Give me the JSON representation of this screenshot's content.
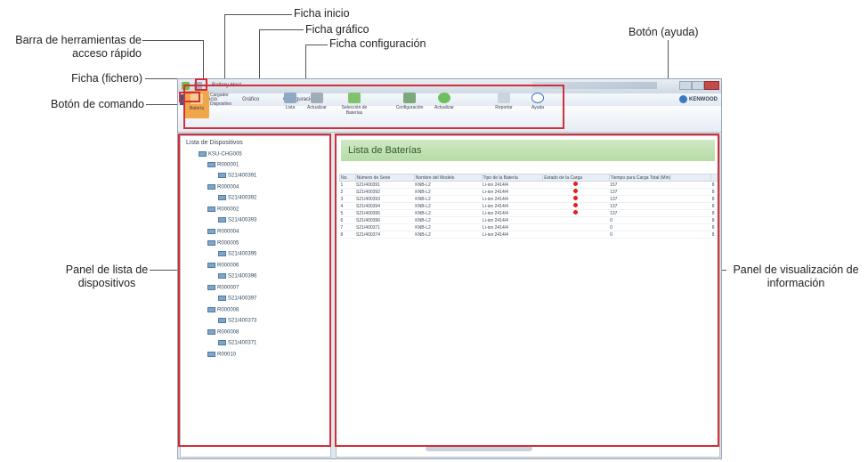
{
  "callouts": {
    "ficha_inicio": "Ficha inicio",
    "ficha_grafico": "Ficha gráfico",
    "ficha_configuracion": "Ficha configuración",
    "barra_herramientas": "Barra de herramientas de acceso rápido",
    "boton_ayuda": "Botón (ayuda)",
    "ficha_fichero": "Ficha (fichero)",
    "boton_comando": "Botón de comando",
    "panel_lista": "Panel de lista de dispositivos",
    "panel_visualizacion": "Panel de visualización de información"
  },
  "app": {
    "title": "Battery Host",
    "tabs": [
      "Inicio",
      "Gráfico",
      "Configuración"
    ],
    "brand": "KENWOOD",
    "ribbon_buttons": [
      "Batería",
      "Cargador",
      "Dispositivo",
      "Lista",
      "Actualizar",
      "Selección de Baterías",
      "Configuración",
      "Actualizar",
      "Reportar",
      "Ayuda"
    ]
  },
  "device_list": {
    "title": "Lista de Dispositivos",
    "root": "KSU-CHG005",
    "items": [
      "R000001",
      "S21/400391",
      "R000004",
      "S21/400392",
      "R000002",
      "S21/400393",
      "R000004",
      "R000005",
      "S21/400395",
      "R000006",
      "S21/400396",
      "R000007",
      "S21/400397",
      "R000008",
      "S21/400373",
      "R000008",
      "S21/400371",
      "R00010"
    ]
  },
  "battery_panel": {
    "title": "Lista de Baterías",
    "columns": [
      "No.",
      "Número de Serie",
      "Nombre del Modelo",
      "Tipo de la Batería",
      "Estado de la Carga",
      "Tiempo para Carga Total (Min)",
      ""
    ],
    "rows": [
      [
        "1",
        "S21/400391",
        "KNB-L2",
        "Li-ion 2414/4",
        "red",
        "157",
        "8"
      ],
      [
        "2",
        "S21/400392",
        "KNB-L2",
        "Li-ion 2414/4",
        "red",
        "137",
        "8"
      ],
      [
        "3",
        "S21/400393",
        "KNB-L2",
        "Li-ion 2414/4",
        "red",
        "137",
        "8"
      ],
      [
        "4",
        "S21/400394",
        "KNB-L2",
        "Li-ion 2414/4",
        "red",
        "137",
        "8"
      ],
      [
        "5",
        "S21/400395",
        "KNB-L2",
        "Li-ion 2414/4",
        "red",
        "137",
        "8"
      ],
      [
        "6",
        "S21/400396",
        "KNB-L2",
        "Li-ion 2414/4",
        "",
        "0",
        "8"
      ],
      [
        "7",
        "S21/400371",
        "KNB-L2",
        "Li-ion 2414/4",
        "",
        "0",
        "8"
      ],
      [
        "8",
        "S21/400374",
        "KNB-L2",
        "Li-ion 2414/4",
        "",
        "0",
        "8"
      ]
    ]
  },
  "colors": {
    "highlight": "#d0303a",
    "header_green": "#b6dca6",
    "status_red": "#e02020"
  }
}
